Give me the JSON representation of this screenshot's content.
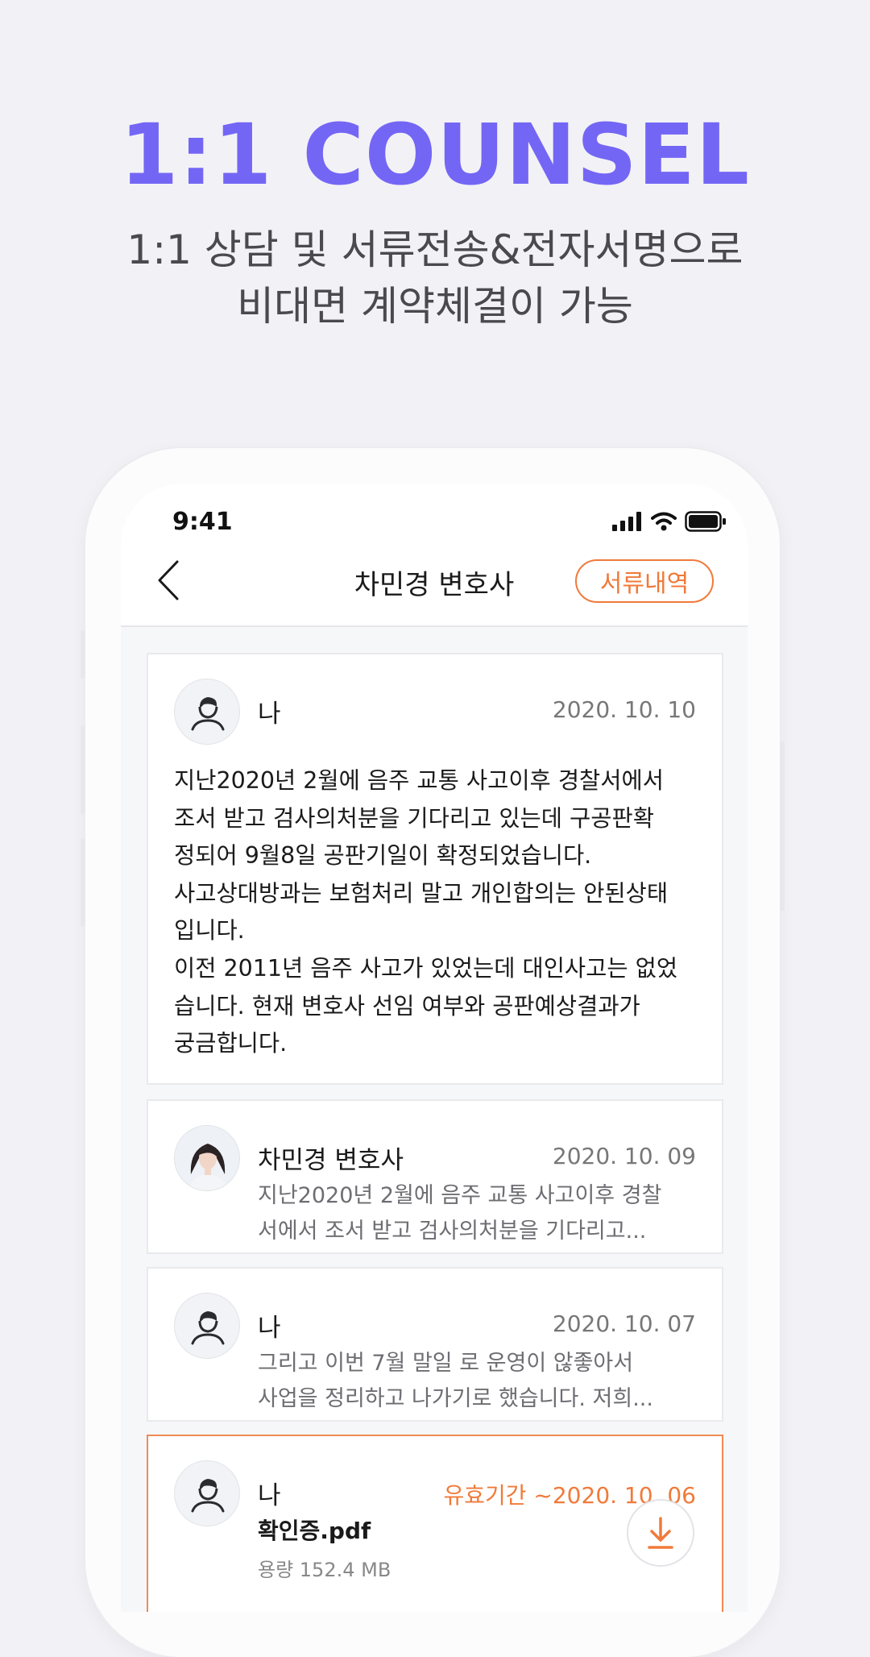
{
  "hero": {
    "title": "1:1 COUNSEL",
    "subtitle_line1": "1:1 상담 및 서류전송&전자서명으로",
    "subtitle_line2": "비대면 계약체결이 가능"
  },
  "status_bar": {
    "time": "9:41"
  },
  "nav": {
    "title": "차민경 변호사",
    "docs_button": "서류내역"
  },
  "messages": [
    {
      "sender": "나",
      "date": "2020. 10. 10",
      "body": "지난2020년 2월에 음주 교통 사고이후 경찰서에서\n조서 받고 검사의처분을 기다리고 있는데 구공판확\n정되어 9월8일 공판기일이 확정되었습니다.\n사고상대방과는 보험처리 말고 개인합의는 안된상태\n입니다.\n이전 2011년 음주 사고가 있었는데 대인사고는 없었\n습니다. 현재 변호사 선임 여부와 공판예상결과가\n궁금합니다."
    },
    {
      "sender": "차민경 변호사",
      "date": "2020. 10. 09",
      "preview": "지난2020년 2월에 음주 교통 사고이후 경찰\n서에서 조서 받고 검사의처분을 기다리고..."
    },
    {
      "sender": "나",
      "date": "2020. 10. 07",
      "preview": "그리고 이번 7월 말일 로 운영이 않좋아서\n사업을 정리하고 나가기로 했습니다. 저희..."
    },
    {
      "sender": "나",
      "validity": "유효기간 ~2020. 10. 06",
      "file_name": "확인증.pdf",
      "file_size": "용량 152.4 MB"
    }
  ],
  "colors": {
    "accent": "#7466f5",
    "orange": "#f07a3a"
  }
}
